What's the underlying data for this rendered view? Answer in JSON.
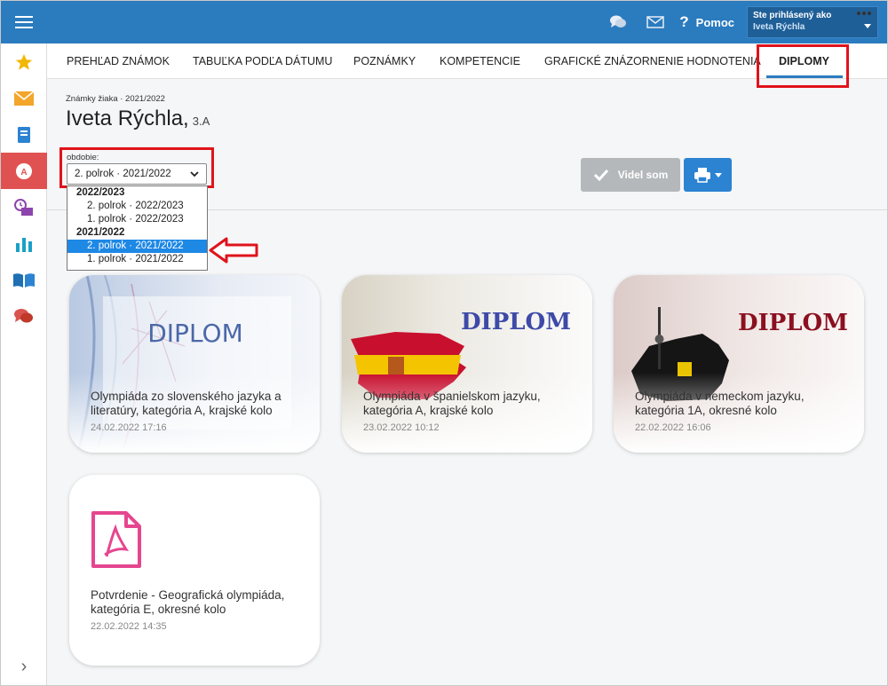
{
  "header": {
    "help_label": "Pomoc",
    "user_label": "Ste prihlásený ako",
    "user_name": "Iveta Rýchla"
  },
  "tabs": [
    {
      "label": "PREHĽAD ZNÁMOK"
    },
    {
      "label": "TABUĽKA PODĽA DÁTUMU"
    },
    {
      "label": "POZNÁMKY"
    },
    {
      "label": "KOMPETENCIE"
    },
    {
      "label": "GRAFICKÉ ZNÁZORNENIE HODNOTENIA"
    },
    {
      "label": "DIPLOMY"
    }
  ],
  "page": {
    "breadcrumb": "Známky žiaka · 2021/2022",
    "student_name": "Iveta Rýchla,",
    "student_class": "3.A"
  },
  "period": {
    "label": "obdobie:",
    "selected": "2. polrok · 2021/2022",
    "groups": [
      {
        "label": "2022/2023",
        "options": [
          "2. polrok · 2022/2023",
          "1. polrok · 2022/2023"
        ]
      },
      {
        "label": "2021/2022",
        "options": [
          "2. polrok · 2021/2022",
          "1. polrok · 2021/2022"
        ]
      }
    ]
  },
  "actions": {
    "seen_label": "Videl som"
  },
  "cards": [
    {
      "image_text": "DIPLOM",
      "title": "Olympiáda zo slovenského jazyka a literatúry, kategória A, krajské kolo",
      "date": "24.02.2022 17:16"
    },
    {
      "image_text": "DIPLOM",
      "title": "Olympiáda v španielskom jazyku, kategória A, krajské kolo",
      "date": "23.02.2022 10:12"
    },
    {
      "image_text": "DIPLOM",
      "title": "Olympiáda v nemeckom jazyku, kategória 1A, okresné kolo",
      "date": "22.02.2022 16:06"
    },
    {
      "image_text": "",
      "title": "Potvrdenie - Geografická olympiáda, kategória E, okresné kolo",
      "date": "22.02.2022 14:35"
    }
  ],
  "colors": {
    "topbar": "#2b7bbf",
    "highlight": "#e0131b",
    "selected_option": "#1e88e5",
    "pdf_icon": "#e6468f"
  }
}
